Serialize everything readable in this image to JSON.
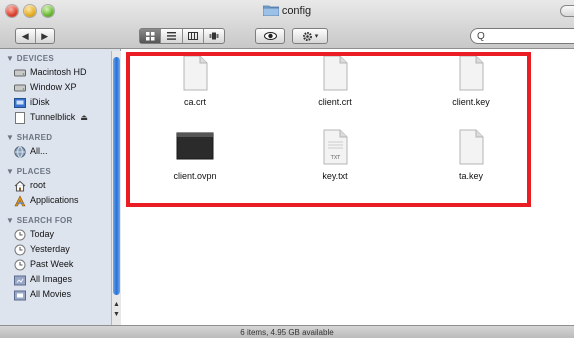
{
  "window": {
    "title": "config"
  },
  "toolbar": {
    "back": "◀",
    "forward": "▶",
    "search_placeholder": "Q"
  },
  "sidebar": {
    "devices": {
      "header": "▼ DEVICES",
      "items": [
        {
          "label": "Macintosh HD",
          "icon": "hard-drive-icon"
        },
        {
          "label": "Window XP",
          "icon": "hard-drive-icon"
        },
        {
          "label": "iDisk",
          "icon": "idisk-icon"
        },
        {
          "label": "Tunnelblick",
          "icon": "disk-image-icon",
          "eject": "⏏"
        }
      ]
    },
    "shared": {
      "header": "▼ SHARED",
      "items": [
        {
          "label": "All...",
          "icon": "network-icon"
        }
      ]
    },
    "places": {
      "header": "▼ PLACES",
      "items": [
        {
          "label": "root",
          "icon": "home-icon"
        },
        {
          "label": "Applications",
          "icon": "applications-icon"
        }
      ]
    },
    "search_for": {
      "header": "▼ SEARCH FOR",
      "items": [
        {
          "label": "Today",
          "icon": "clock-icon"
        },
        {
          "label": "Yesterday",
          "icon": "clock-icon"
        },
        {
          "label": "Past Week",
          "icon": "clock-icon"
        },
        {
          "label": "All Images",
          "icon": "smart-folder-icon"
        },
        {
          "label": "All Movies",
          "icon": "smart-folder-icon"
        }
      ]
    }
  },
  "files": [
    {
      "name": "ca.crt",
      "kind": "document"
    },
    {
      "name": "client.crt",
      "kind": "document"
    },
    {
      "name": "client.key",
      "kind": "document"
    },
    {
      "name": "client.ovpn",
      "kind": "dark-document"
    },
    {
      "name": "key.txt",
      "kind": "text",
      "badge": "TXT"
    },
    {
      "name": "ta.key",
      "kind": "document"
    }
  ],
  "status": {
    "text": "6 items, 4.95 GB available"
  },
  "colors": {
    "selection_border": "#ea1c24",
    "sidebar_bg": "#dde4ee",
    "scroll_thumb": "#2a6fd4"
  }
}
